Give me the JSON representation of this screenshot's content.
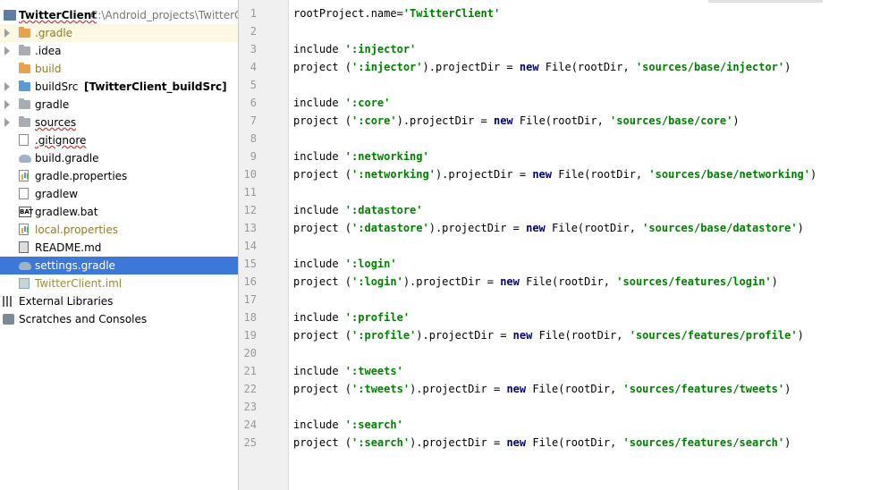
{
  "project": {
    "name": "TwitterClient",
    "path": "C:\\Android_projects\\TwitterClie"
  },
  "tree": [
    {
      "label": ".gradle",
      "icon": "folder-orange-icon",
      "arrow": true,
      "hl": true
    },
    {
      "label": ".idea",
      "icon": "folder-icon",
      "arrow": true
    },
    {
      "label": "build",
      "icon": "folder-orange-icon",
      "arrow": false
    },
    {
      "label": "buildSrc",
      "extra": "[TwitterClient_buildSrc]",
      "icon": "folder-blue-icon",
      "arrow": true
    },
    {
      "label": "gradle",
      "icon": "folder-icon",
      "arrow": true
    },
    {
      "label": "sources",
      "icon": "folder-icon",
      "arrow": true
    },
    {
      "label": ".gitignore",
      "icon": "file-icon"
    },
    {
      "label": "build.gradle",
      "icon": "gradle-icon"
    },
    {
      "label": "gradle.properties",
      "icon": "properties-icon"
    },
    {
      "label": "gradlew",
      "icon": "file-icon"
    },
    {
      "label": "gradlew.bat",
      "icon": "bat-icon"
    },
    {
      "label": "local.properties",
      "icon": "properties-icon"
    },
    {
      "label": "README.md",
      "icon": "markdown-icon"
    },
    {
      "label": "settings.gradle",
      "icon": "gradle-icon",
      "selected": true
    },
    {
      "label": "TwitterClient.iml",
      "icon": "iml-icon"
    },
    {
      "label": "External Libraries",
      "icon": "libraries-icon",
      "root": true
    },
    {
      "label": "Scratches and Consoles",
      "icon": "scratches-icon",
      "root": true
    }
  ],
  "tree_badges": {
    "bat": "BAT"
  },
  "editor": {
    "current_line": 14,
    "lines": [
      [
        {
          "t": "rootProject.name="
        },
        {
          "t": "'TwitterClient'",
          "c": "str"
        }
      ],
      [],
      [
        {
          "t": "include "
        },
        {
          "t": "':injector'",
          "c": "str"
        }
      ],
      [
        {
          "t": "project ("
        },
        {
          "t": "':injector'",
          "c": "str"
        },
        {
          "t": ").projectDir = "
        },
        {
          "t": "new",
          "c": "kw"
        },
        {
          "t": " File(rootDir, "
        },
        {
          "t": "'sources/base/injector'",
          "c": "str"
        },
        {
          "t": ")"
        }
      ],
      [],
      [
        {
          "t": "include "
        },
        {
          "t": "':core'",
          "c": "str"
        }
      ],
      [
        {
          "t": "project ("
        },
        {
          "t": "':core'",
          "c": "str"
        },
        {
          "t": ").projectDir = "
        },
        {
          "t": "new",
          "c": "kw"
        },
        {
          "t": " File(rootDir, "
        },
        {
          "t": "'sources/base/core'",
          "c": "str"
        },
        {
          "t": ")"
        }
      ],
      [],
      [
        {
          "t": "include "
        },
        {
          "t": "':networking'",
          "c": "str"
        }
      ],
      [
        {
          "t": "project ("
        },
        {
          "t": "':networking'",
          "c": "str"
        },
        {
          "t": ").projectDir = "
        },
        {
          "t": "new",
          "c": "kw"
        },
        {
          "t": " File(rootDir, "
        },
        {
          "t": "'sources/base/networking'",
          "c": "str"
        },
        {
          "t": ")"
        }
      ],
      [],
      [
        {
          "t": "include "
        },
        {
          "t": "':datastore'",
          "c": "str"
        }
      ],
      [
        {
          "t": "project ("
        },
        {
          "t": "':datastore'",
          "c": "str"
        },
        {
          "t": ").projectDir = "
        },
        {
          "t": "new",
          "c": "kw"
        },
        {
          "t": " File(rootDir, "
        },
        {
          "t": "'sources/base/datastore'",
          "c": "str"
        },
        {
          "t": ")"
        }
      ],
      [],
      [
        {
          "t": "include "
        },
        {
          "t": "':login'",
          "c": "str"
        }
      ],
      [
        {
          "t": "project ("
        },
        {
          "t": "':login'",
          "c": "str"
        },
        {
          "t": ").projectDir = "
        },
        {
          "t": "new",
          "c": "kw"
        },
        {
          "t": " File(rootDir, "
        },
        {
          "t": "'sources/features/login'",
          "c": "str"
        },
        {
          "t": ")"
        }
      ],
      [],
      [
        {
          "t": "include "
        },
        {
          "t": "':profile'",
          "c": "str"
        }
      ],
      [
        {
          "t": "project ("
        },
        {
          "t": "':profile'",
          "c": "str"
        },
        {
          "t": ").projectDir = "
        },
        {
          "t": "new",
          "c": "kw"
        },
        {
          "t": " File(rootDir, "
        },
        {
          "t": "'sources/features/profile'",
          "c": "str"
        },
        {
          "t": ")"
        }
      ],
      [],
      [
        {
          "t": "include "
        },
        {
          "t": "':tweets'",
          "c": "str"
        }
      ],
      [
        {
          "t": "project ("
        },
        {
          "t": "':tweets'",
          "c": "str"
        },
        {
          "t": ").projectDir = "
        },
        {
          "t": "new",
          "c": "kw"
        },
        {
          "t": " File(rootDir, "
        },
        {
          "t": "'sources/features/tweets'",
          "c": "str"
        },
        {
          "t": ")"
        }
      ],
      [],
      [
        {
          "t": "include "
        },
        {
          "t": "':search'",
          "c": "str"
        }
      ],
      [
        {
          "t": "project ("
        },
        {
          "t": "':search'",
          "c": "str"
        },
        {
          "t": ").projectDir = "
        },
        {
          "t": "new",
          "c": "kw"
        },
        {
          "t": " File(rootDir, "
        },
        {
          "t": "'sources/features/search'",
          "c": "str"
        },
        {
          "t": ")"
        }
      ]
    ]
  }
}
